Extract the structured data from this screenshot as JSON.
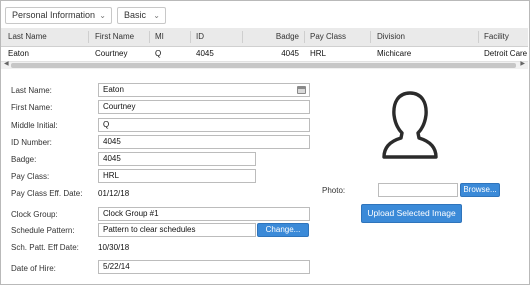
{
  "toolbar": {
    "view_select": "Personal Information",
    "mode_select": "Basic"
  },
  "grid": {
    "columns": [
      "Last Name",
      "First Name",
      "MI",
      "ID",
      "Badge",
      "Pay Class",
      "Division",
      "Facility"
    ],
    "row": [
      "Eaton",
      "Courtney",
      "Q",
      "4045",
      "4045",
      "HRL",
      "Michicare",
      "Detroit Care"
    ]
  },
  "form": {
    "last_name": {
      "label": "Last Name:",
      "value": "Eaton"
    },
    "first_name": {
      "label": "First Name:",
      "value": "Courtney"
    },
    "middle_initial": {
      "label": "Middle Initial:",
      "value": "Q"
    },
    "id_number": {
      "label": "ID Number:",
      "value": "4045"
    },
    "badge": {
      "label": "Badge:",
      "value": "4045"
    },
    "pay_class": {
      "label": "Pay Class:",
      "value": "HRL"
    },
    "pay_class_eff_date": {
      "label": "Pay Class Eff. Date:",
      "value": "01/12/18"
    },
    "clock_group": {
      "label": "Clock Group:",
      "value": "Clock Group #1"
    },
    "schedule_pattern": {
      "label": "Schedule Pattern:",
      "value": "Pattern to clear schedules",
      "button": "Change..."
    },
    "sch_patt_eff_date": {
      "label": "Sch. Patt. Eff Date:",
      "value": "10/30/18"
    },
    "date_of_hire": {
      "label": "Date of Hire:",
      "value": "5/22/14"
    }
  },
  "photo": {
    "label": "Photo:",
    "file_value": "",
    "browse_label": "Browse...",
    "upload_label": "Upload Selected Image"
  },
  "icons": {
    "chevron": "chevron-down-icon",
    "calendar": "calendar-icon",
    "avatar": "user-silhouette-icon"
  },
  "colors": {
    "accent": "#3b8ad8",
    "header_bg": "#eaeaea"
  }
}
